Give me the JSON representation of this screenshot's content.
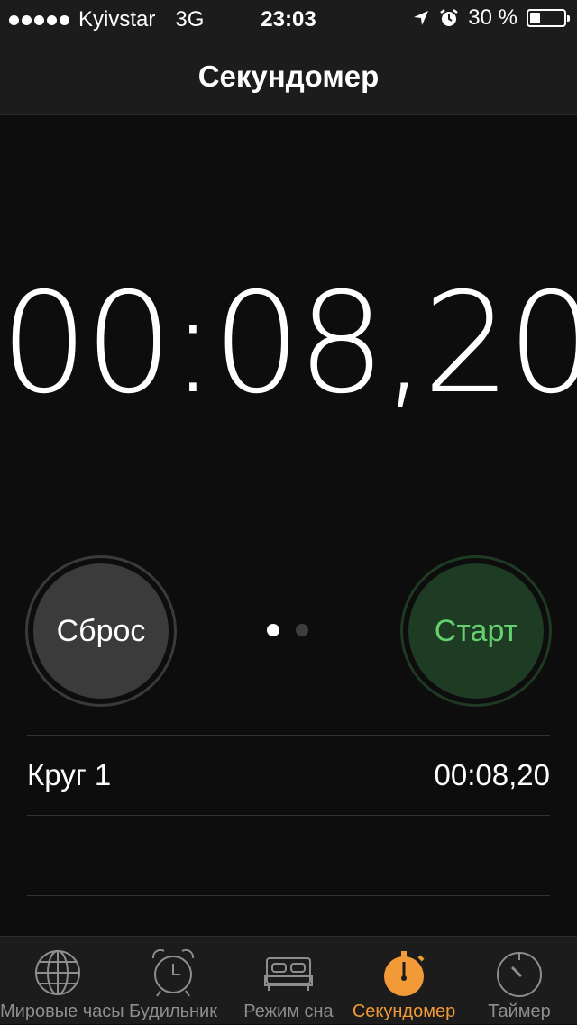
{
  "status_bar": {
    "carrier": "Kyivstar",
    "network": "3G",
    "time": "23:03",
    "battery_percent_text": "30 %",
    "battery_level": 0.3,
    "location_icon": "location-arrow-icon",
    "alarm_icon": "alarm-clock-icon"
  },
  "nav": {
    "title": "Секундомер"
  },
  "stopwatch": {
    "display": "00:08,20"
  },
  "controls": {
    "reset_label": "Сброс",
    "start_label": "Старт",
    "start_color": "#64d06e",
    "page_count": 2,
    "page_active": 1
  },
  "laps": [
    {
      "label": "Круг 1",
      "time": "00:08,20"
    }
  ],
  "tabs": [
    {
      "label": "Мировые часы",
      "icon": "globe-icon",
      "active": false
    },
    {
      "label": "Будильник",
      "icon": "alarm-clock-icon",
      "active": false
    },
    {
      "label": "Режим сна",
      "icon": "bed-icon",
      "active": false
    },
    {
      "label": "Секундомер",
      "icon": "stopwatch-icon",
      "active": true
    },
    {
      "label": "Таймер",
      "icon": "timer-icon",
      "active": false
    }
  ],
  "colors": {
    "accent": "#f19a37",
    "inactive_tab": "#8e8e8e"
  }
}
